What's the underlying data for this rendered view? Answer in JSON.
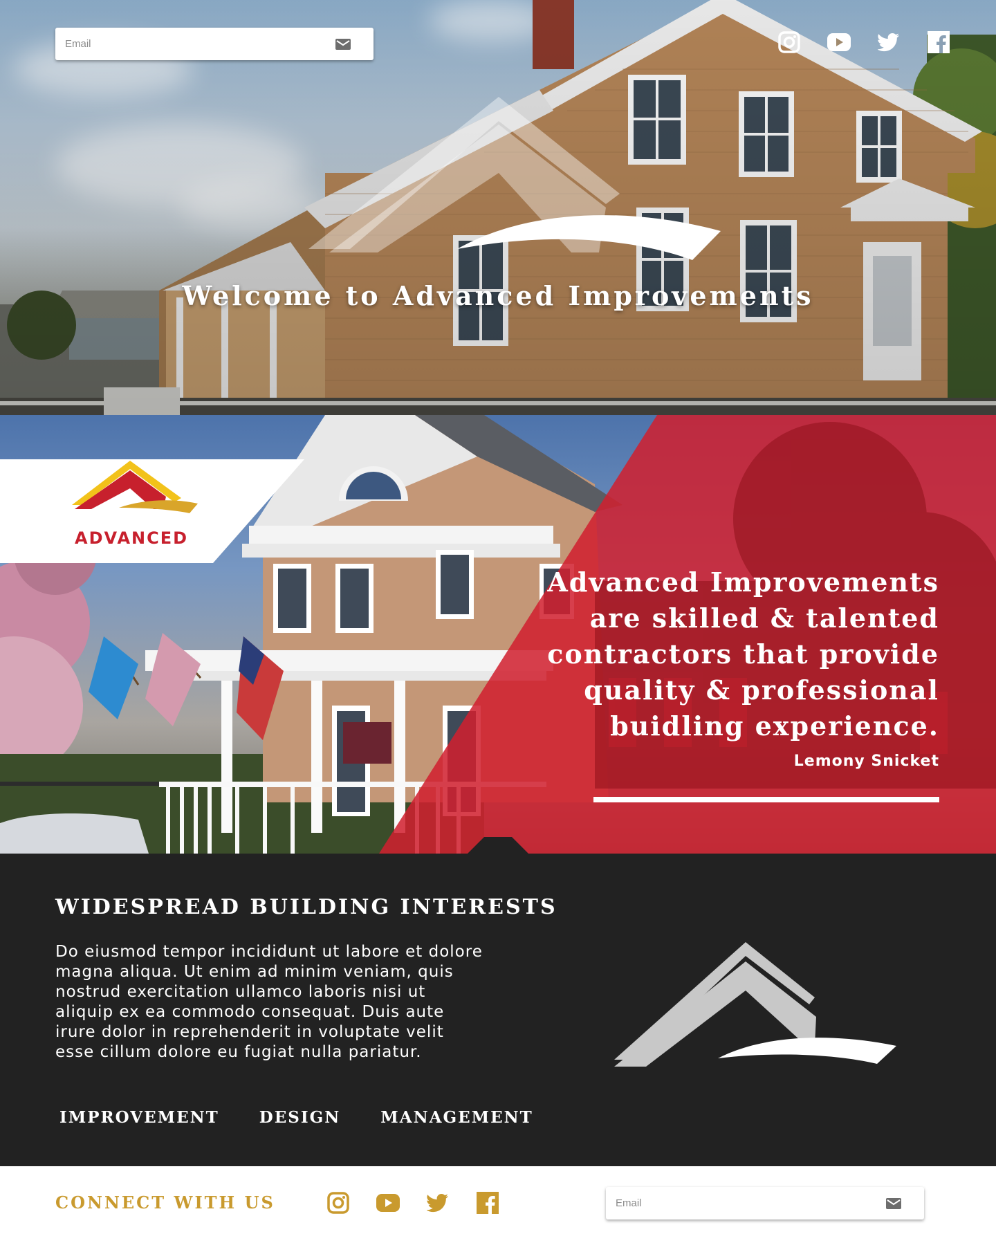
{
  "hero": {
    "email_placeholder": "Email",
    "title": "Welcome to Advanced Improvements",
    "social": [
      "instagram-icon",
      "youtube-icon",
      "twitter-icon",
      "facebook-icon"
    ]
  },
  "quote": {
    "logo_text": "ADVANCED",
    "sign_text": "ADVANCED",
    "lines": [
      "Advanced Improvements",
      "are skilled & talented",
      "contractors that provide",
      "quality & professional",
      "buidling experience."
    ],
    "author": "Lemony Snicket"
  },
  "info": {
    "title": "WIDESPREAD BUILDING INTERESTS",
    "body_lines": [
      "Do eiusmod tempor incididunt ut labore et dolore",
      "magna aliqua. Ut enim ad minim veniam, quis",
      "nostrud exercitation ullamco laboris nisi ut",
      "aliquip ex ea commodo consequat. Duis aute",
      "irure dolor in reprehenderit in voluptate velit",
      "esse cillum dolore eu fugiat nulla pariatur."
    ],
    "links": [
      "IMPROVEMENT",
      "DESIGN",
      "MANAGEMENT"
    ]
  },
  "footer": {
    "connect": "CONNECT WITH US",
    "email_placeholder": "Email",
    "social": [
      "instagram-icon",
      "youtube-icon",
      "twitter-icon",
      "facebook-icon"
    ]
  },
  "colors": {
    "brand_red": "#d0202e",
    "brand_gold": "#c99a2e",
    "dark": "#222222",
    "logo_gray": "#c8c8c8"
  }
}
